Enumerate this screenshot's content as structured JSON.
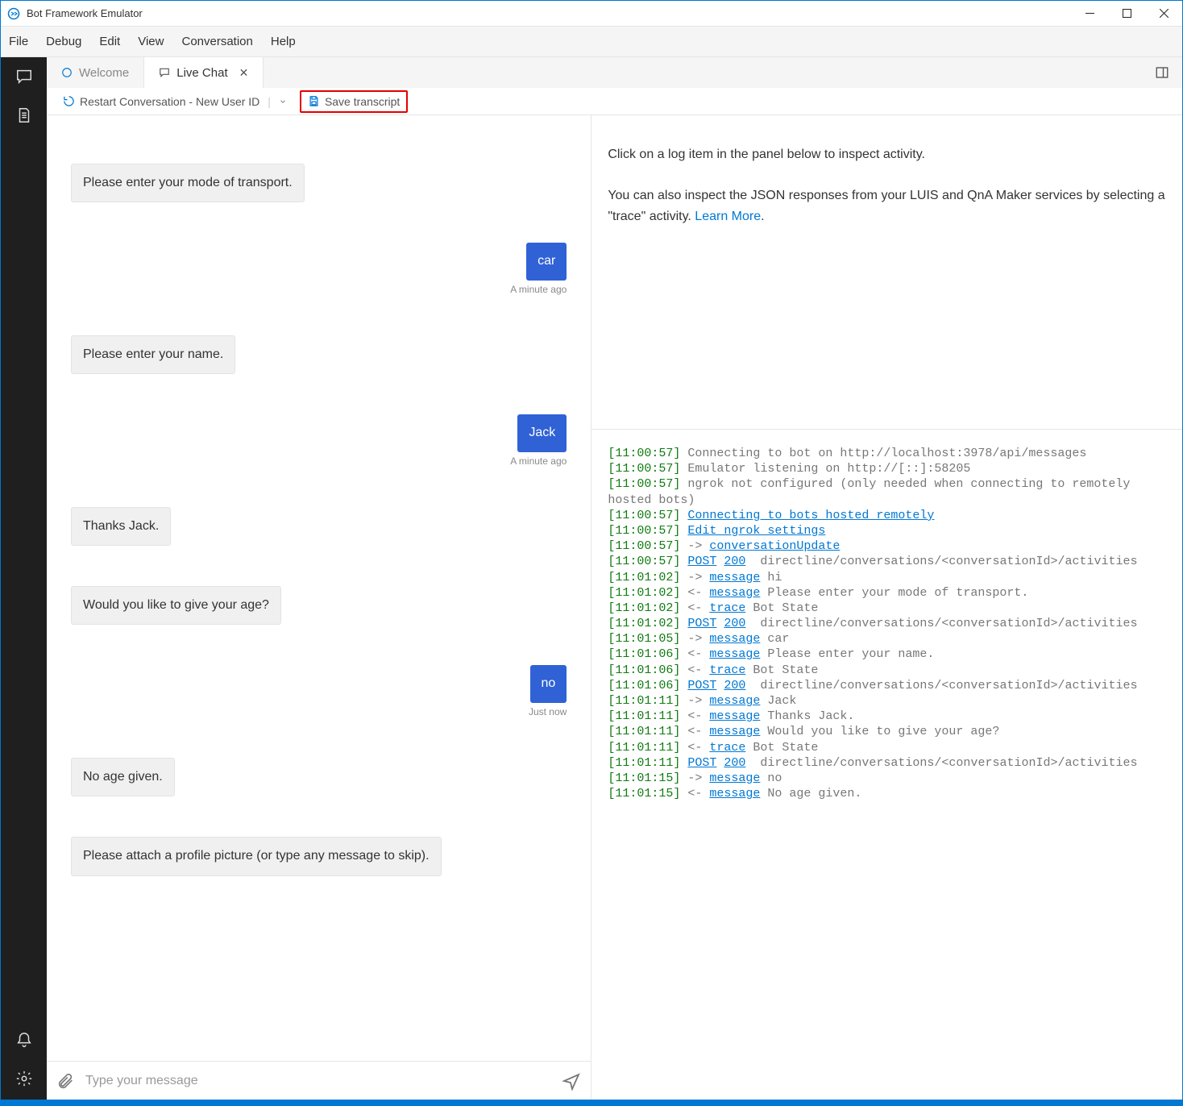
{
  "app": {
    "title": "Bot Framework Emulator"
  },
  "menu": {
    "items": [
      "File",
      "Debug",
      "Edit",
      "View",
      "Conversation",
      "Help"
    ]
  },
  "tabs": {
    "welcome": {
      "label": "Welcome"
    },
    "livechat": {
      "label": "Live Chat"
    }
  },
  "toolbar": {
    "restart": "Restart Conversation - New User ID",
    "save": "Save transcript"
  },
  "chat": {
    "messages": [
      {
        "side": "bot",
        "text": "Please enter your mode of transport.",
        "ts": ""
      },
      {
        "side": "user",
        "text": "car",
        "ts": "A minute ago"
      },
      {
        "side": "bot",
        "text": "Please enter your name.",
        "ts": ""
      },
      {
        "side": "user",
        "text": "Jack",
        "ts": "A minute ago"
      },
      {
        "side": "bot",
        "text": "Thanks Jack.",
        "ts": ""
      },
      {
        "side": "bot",
        "text": "Would you like to give your age?",
        "ts": ""
      },
      {
        "side": "user",
        "text": "no",
        "ts": "Just now"
      },
      {
        "side": "bot",
        "text": "No age given.",
        "ts": ""
      },
      {
        "side": "bot",
        "text": "Please attach a profile picture (or type any message to skip).",
        "ts": ""
      }
    ],
    "placeholder": "Type your message"
  },
  "inspector": {
    "line1": "Click on a log item in the panel below to inspect activity.",
    "line2a": "You can also inspect the JSON responses from your LUIS and QnA Maker services by selecting a \"trace\" activity. ",
    "learnmore": "Learn More",
    "period": "."
  },
  "log": [
    {
      "t": "[11:00:57]",
      "p": [
        {
          "c": "g",
          "v": " Connecting to bot on http://localhost:3978/api/messages"
        }
      ]
    },
    {
      "t": "[11:00:57]",
      "p": [
        {
          "c": "g",
          "v": " Emulator listening on http://[::]:58205"
        }
      ]
    },
    {
      "t": "[11:00:57]",
      "p": [
        {
          "c": "g",
          "v": " ngrok not configured (only needed when connecting to remotely hosted bots)"
        }
      ]
    },
    {
      "t": "[11:00:57]",
      "p": [
        {
          "c": "",
          "v": " "
        },
        {
          "c": "b",
          "v": "Connecting to bots hosted remotely"
        }
      ]
    },
    {
      "t": "[11:00:57]",
      "p": [
        {
          "c": "",
          "v": " "
        },
        {
          "c": "b",
          "v": "Edit ngrok settings"
        }
      ]
    },
    {
      "t": "[11:00:57]",
      "p": [
        {
          "c": "g",
          "v": " -> "
        },
        {
          "c": "b",
          "v": "conversationUpdate"
        }
      ]
    },
    {
      "t": "[11:00:57]",
      "p": [
        {
          "c": "",
          "v": " "
        },
        {
          "c": "b",
          "v": "POST"
        },
        {
          "c": "",
          "v": " "
        },
        {
          "c": "b",
          "v": "200"
        },
        {
          "c": "g",
          "v": "  directline/conversations/<conversationId>/activities"
        }
      ]
    },
    {
      "t": "[11:01:02]",
      "p": [
        {
          "c": "g",
          "v": " -> "
        },
        {
          "c": "b",
          "v": "message"
        },
        {
          "c": "g",
          "v": " hi"
        }
      ]
    },
    {
      "t": "[11:01:02]",
      "p": [
        {
          "c": "g",
          "v": " <- "
        },
        {
          "c": "b",
          "v": "message"
        },
        {
          "c": "g",
          "v": " Please enter your mode of transport."
        }
      ]
    },
    {
      "t": "[11:01:02]",
      "p": [
        {
          "c": "g",
          "v": " <- "
        },
        {
          "c": "b",
          "v": "trace"
        },
        {
          "c": "g",
          "v": " Bot State"
        }
      ]
    },
    {
      "t": "[11:01:02]",
      "p": [
        {
          "c": "",
          "v": " "
        },
        {
          "c": "b",
          "v": "POST"
        },
        {
          "c": "",
          "v": " "
        },
        {
          "c": "b",
          "v": "200"
        },
        {
          "c": "g",
          "v": "  directline/conversations/<conversationId>/activities"
        }
      ]
    },
    {
      "t": "[11:01:05]",
      "p": [
        {
          "c": "g",
          "v": " -> "
        },
        {
          "c": "b",
          "v": "message"
        },
        {
          "c": "g",
          "v": " car"
        }
      ]
    },
    {
      "t": "[11:01:06]",
      "p": [
        {
          "c": "g",
          "v": " <- "
        },
        {
          "c": "b",
          "v": "message"
        },
        {
          "c": "g",
          "v": " Please enter your name."
        }
      ]
    },
    {
      "t": "[11:01:06]",
      "p": [
        {
          "c": "g",
          "v": " <- "
        },
        {
          "c": "b",
          "v": "trace"
        },
        {
          "c": "g",
          "v": " Bot State"
        }
      ]
    },
    {
      "t": "[11:01:06]",
      "p": [
        {
          "c": "",
          "v": " "
        },
        {
          "c": "b",
          "v": "POST"
        },
        {
          "c": "",
          "v": " "
        },
        {
          "c": "b",
          "v": "200"
        },
        {
          "c": "g",
          "v": "  directline/conversations/<conversationId>/activities"
        }
      ]
    },
    {
      "t": "[11:01:11]",
      "p": [
        {
          "c": "g",
          "v": " -> "
        },
        {
          "c": "b",
          "v": "message"
        },
        {
          "c": "g",
          "v": " Jack"
        }
      ]
    },
    {
      "t": "[11:01:11]",
      "p": [
        {
          "c": "g",
          "v": " <- "
        },
        {
          "c": "b",
          "v": "message"
        },
        {
          "c": "g",
          "v": " Thanks Jack."
        }
      ]
    },
    {
      "t": "[11:01:11]",
      "p": [
        {
          "c": "g",
          "v": " <- "
        },
        {
          "c": "b",
          "v": "message"
        },
        {
          "c": "g",
          "v": " Would you like to give your age?"
        }
      ]
    },
    {
      "t": "[11:01:11]",
      "p": [
        {
          "c": "g",
          "v": " <- "
        },
        {
          "c": "b",
          "v": "trace"
        },
        {
          "c": "g",
          "v": " Bot State"
        }
      ]
    },
    {
      "t": "[11:01:11]",
      "p": [
        {
          "c": "",
          "v": " "
        },
        {
          "c": "b",
          "v": "POST"
        },
        {
          "c": "",
          "v": " "
        },
        {
          "c": "b",
          "v": "200"
        },
        {
          "c": "g",
          "v": "  directline/conversations/<conversationId>/activities"
        }
      ]
    },
    {
      "t": "[11:01:15]",
      "p": [
        {
          "c": "g",
          "v": " -> "
        },
        {
          "c": "b",
          "v": "message"
        },
        {
          "c": "g",
          "v": " no"
        }
      ]
    },
    {
      "t": "[11:01:15]",
      "p": [
        {
          "c": "g",
          "v": " <- "
        },
        {
          "c": "b",
          "v": "message"
        },
        {
          "c": "g",
          "v": " No age given."
        }
      ]
    }
  ]
}
